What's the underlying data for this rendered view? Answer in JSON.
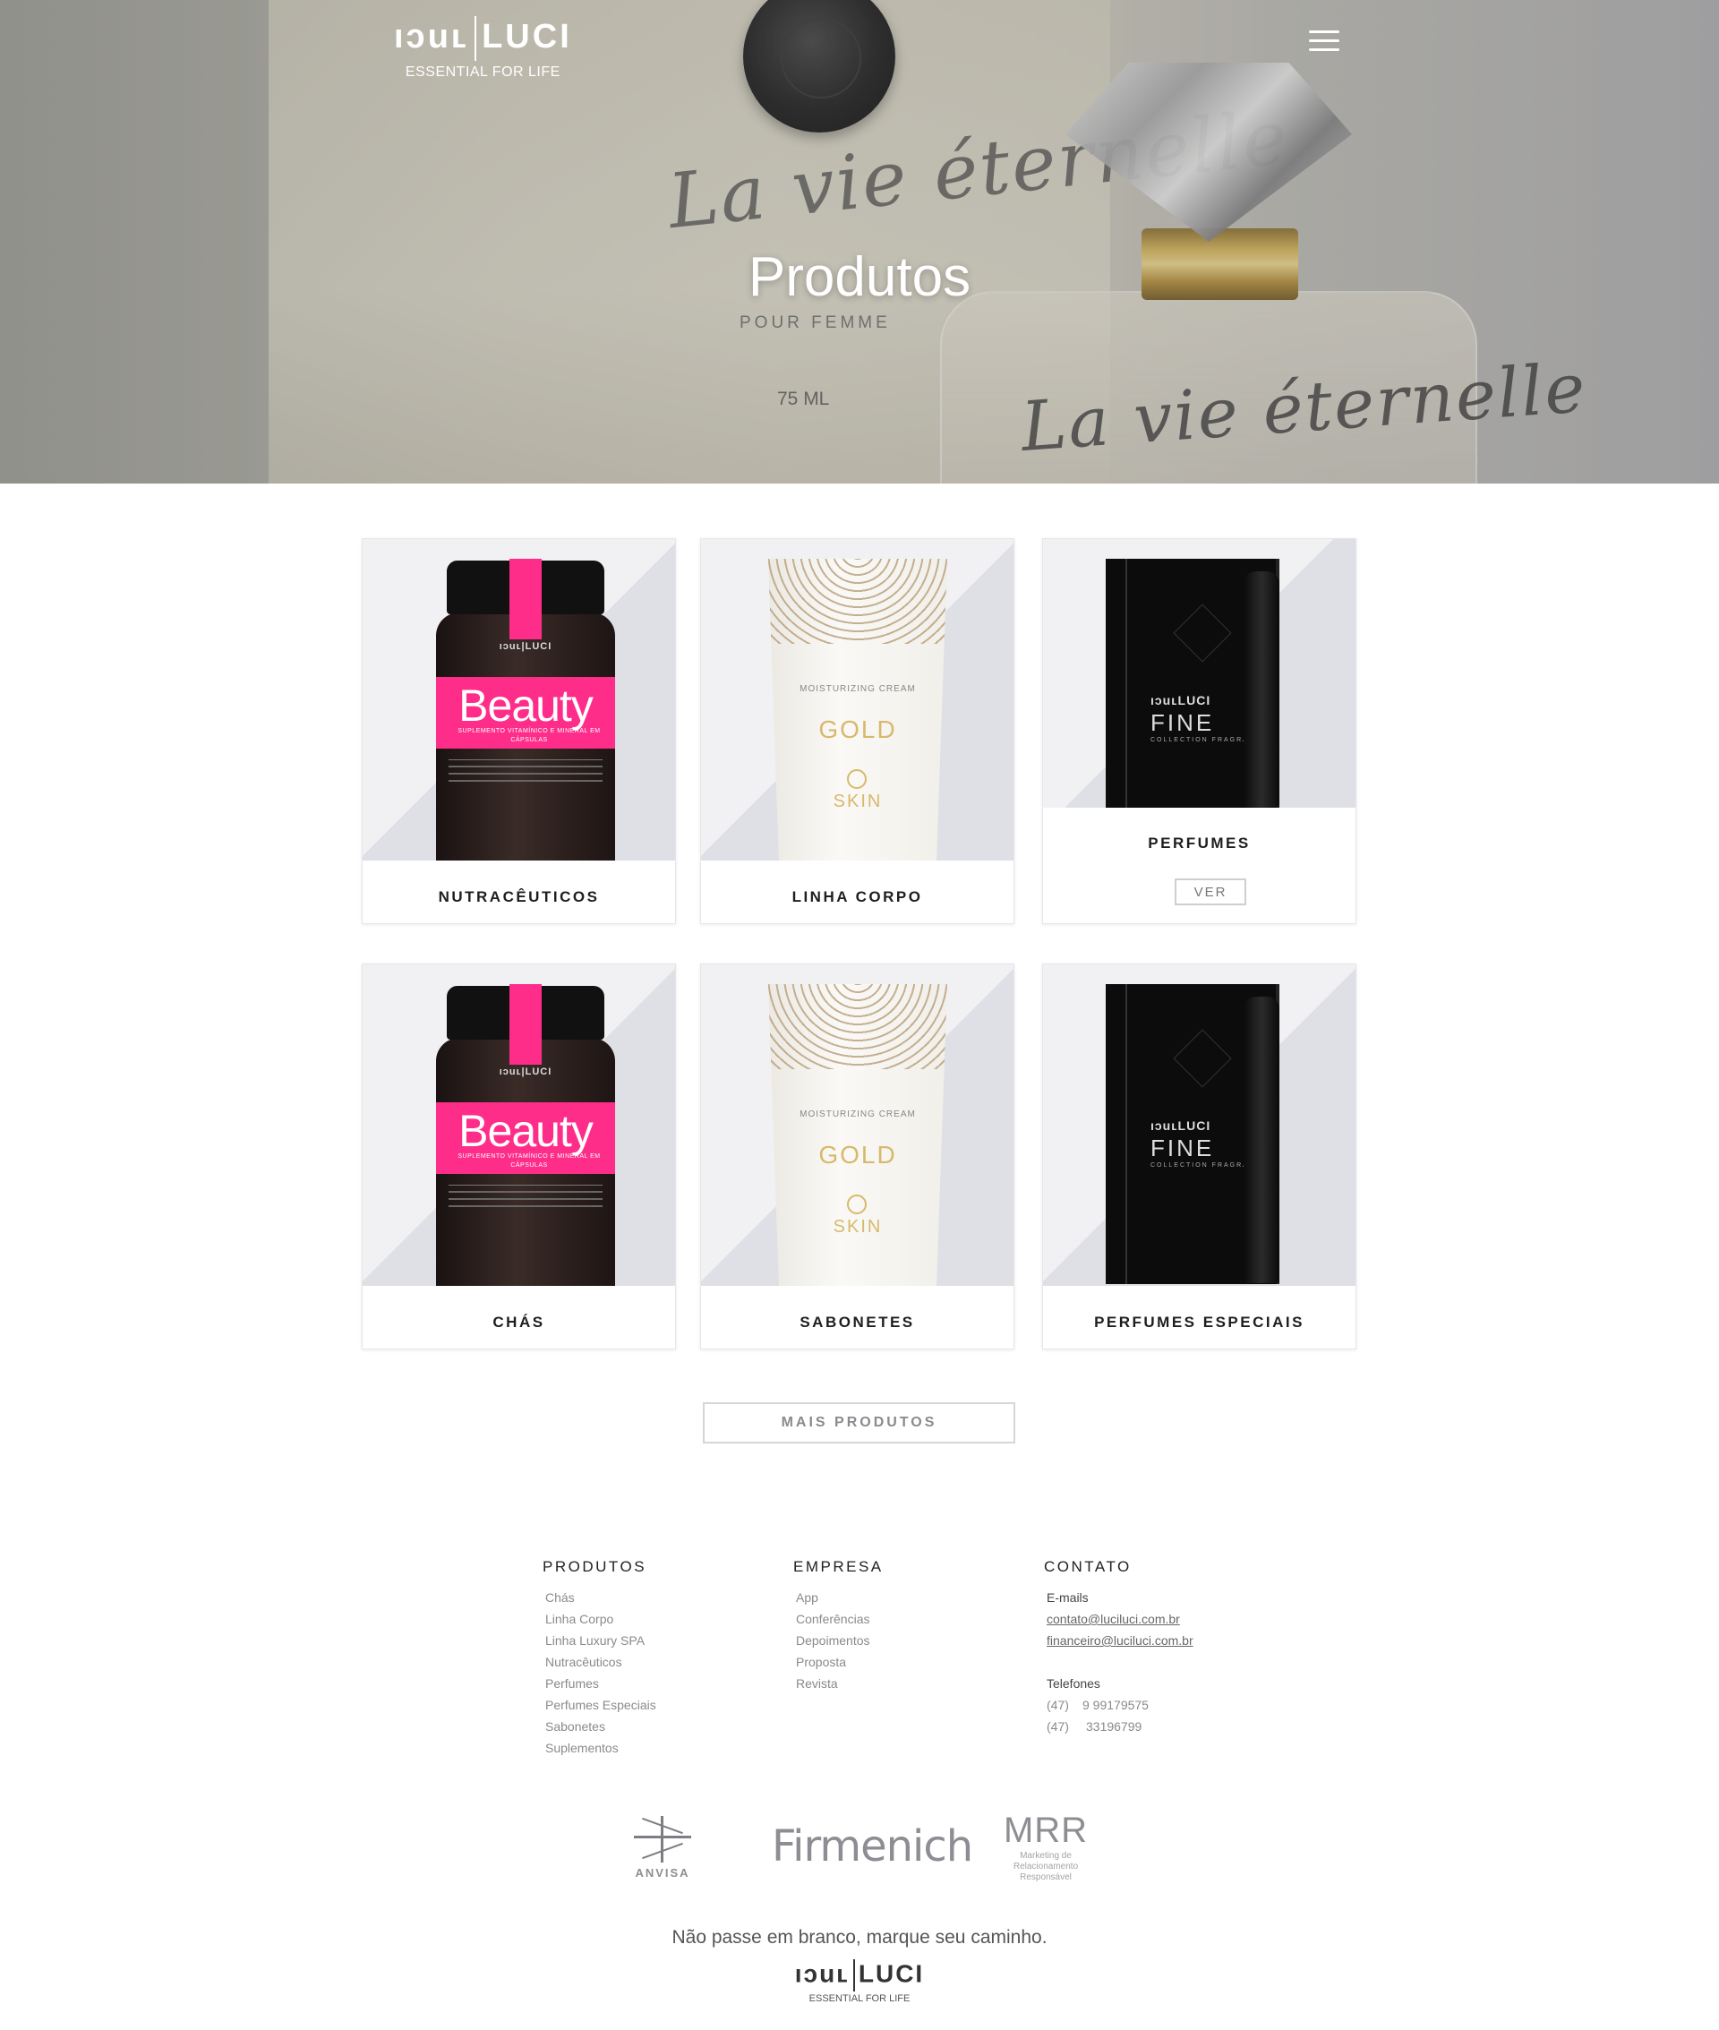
{
  "header": {
    "logo_left": "ıɔuʟ",
    "logo_right": "LUCI",
    "tagline": "ESSENTIAL FOR LIFE",
    "menu_icon": "hamburger-menu-icon"
  },
  "hero": {
    "title": "Produtos",
    "script_top": "La vie éternelle",
    "pour": "POUR FEMME",
    "volume": "75 ML",
    "script_bottom": "La vie éternelle"
  },
  "products": [
    {
      "label": "NUTRACÊUTICOS",
      "image": "beauty-supplement-jar"
    },
    {
      "label": "LINHA CORPO",
      "image": "gold-moisturizing-cream-tube"
    },
    {
      "label": "PERFUMES",
      "image": "fine-fragrance-box",
      "action": "VER"
    },
    {
      "label": "CHÁS",
      "image": "beauty-supplement-jar"
    },
    {
      "label": "SABONETES",
      "image": "gold-moisturizing-cream-tube"
    },
    {
      "label": "PERFUMES ESPECIAIS",
      "image": "fine-fragrance-box"
    }
  ],
  "product_art": {
    "jar_brand": "ıɔuʟ|LUCI",
    "jar_word": "Beauty",
    "jar_sub": "SUPLEMENTO VITAMÍNICO E MINERAL EM CÁPSULAS",
    "tube_top": "MOISTURIZING CREAM",
    "tube_mid": "GOLD",
    "tube_low": "SKIN",
    "box_brand": "ıɔuʟLUCI",
    "box_word": "FINE",
    "box_sub": "COLLECTION FRAGRANCE"
  },
  "more_button": "MAIS PRODUTOS",
  "footer": {
    "produtos": {
      "title": "PRODUTOS",
      "links": [
        "Chás",
        "Linha Corpo",
        "Linha Luxury SPA",
        "Nutracêuticos",
        "Perfumes",
        "Perfumes Especiais",
        "Sabonetes",
        "Suplementos"
      ]
    },
    "empresa": {
      "title": "EMPRESA",
      "links": [
        "App",
        "Conferências",
        "Depoimentos",
        "Proposta",
        "Revista"
      ]
    },
    "contato": {
      "title": "CONTATO",
      "emails_label": "E-mails",
      "emails": [
        "contato@luciluci.com.br",
        "financeiro@luciluci.com.br"
      ],
      "phones_label": "Telefones",
      "phones": [
        [
          "(47)",
          "9 99179575"
        ],
        [
          "(47)",
          "33196799"
        ]
      ]
    }
  },
  "partners": {
    "anvisa": "ANVISA",
    "firmenich": "Firmenich",
    "mrr": "MRR",
    "mrr_sub": "Marketing de Relacionamento Responsável"
  },
  "slogan": "Não passe em branco, marque seu caminho.",
  "footer_logo": {
    "left": "ıɔuʟ",
    "right": "LUCI",
    "tagline": "ESSENTIAL FOR LIFE"
  }
}
